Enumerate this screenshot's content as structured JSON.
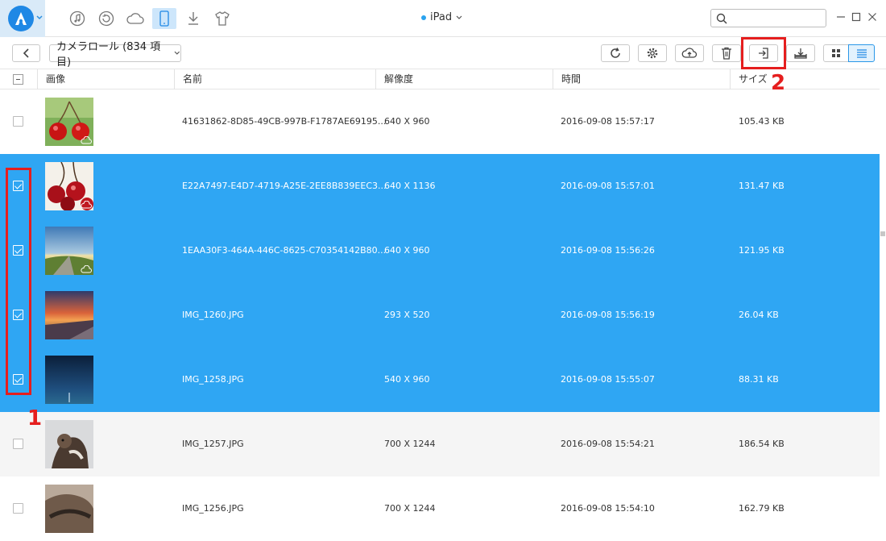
{
  "titlebar": {
    "device_name": "iPad",
    "search_placeholder": "",
    "nav_icons": [
      "music-icon",
      "history-icon",
      "cloud-icon",
      "device-icon",
      "download-icon",
      "tshirt-icon"
    ]
  },
  "toolbar": {
    "album_label": "カメラロール (834 項目)"
  },
  "columns": {
    "image": "画像",
    "name": "名前",
    "resolution": "解像度",
    "time": "時間",
    "size": "サイズ"
  },
  "rows": [
    {
      "name": "41631862-8D85-49CB-997B-F1787AE69195...",
      "resolution": "640 X 960",
      "time": "2016-09-08 15:57:17",
      "size": "105.43 KB",
      "selected": false
    },
    {
      "name": "E22A7497-E4D7-4719-A25E-2EE8B839EEC3...",
      "resolution": "640 X 1136",
      "time": "2016-09-08 15:57:01",
      "size": "131.47 KB",
      "selected": true
    },
    {
      "name": "1EAA30F3-464A-446C-8625-C70354142B80...",
      "resolution": "640 X 960",
      "time": "2016-09-08 15:56:26",
      "size": "121.95 KB",
      "selected": true
    },
    {
      "name": "IMG_1260.JPG",
      "resolution": "293 X 520",
      "time": "2016-09-08 15:56:19",
      "size": "26.04 KB",
      "selected": true
    },
    {
      "name": "IMG_1258.JPG",
      "resolution": "540 X 960",
      "time": "2016-09-08 15:55:07",
      "size": "88.31 KB",
      "selected": true
    },
    {
      "name": "IMG_1257.JPG",
      "resolution": "700 X 1244",
      "time": "2016-09-08 15:54:21",
      "size": "186.54 KB",
      "selected": false
    },
    {
      "name": "IMG_1256.JPG",
      "resolution": "700 X 1244",
      "time": "2016-09-08 15:54:10",
      "size": "162.79 KB",
      "selected": false
    }
  ],
  "annotations": {
    "marker_1": "1",
    "marker_2": "2"
  },
  "colors": {
    "selection": "#2fa6f3",
    "accent": "#1f88e5",
    "annotation": "#e51e1e"
  }
}
